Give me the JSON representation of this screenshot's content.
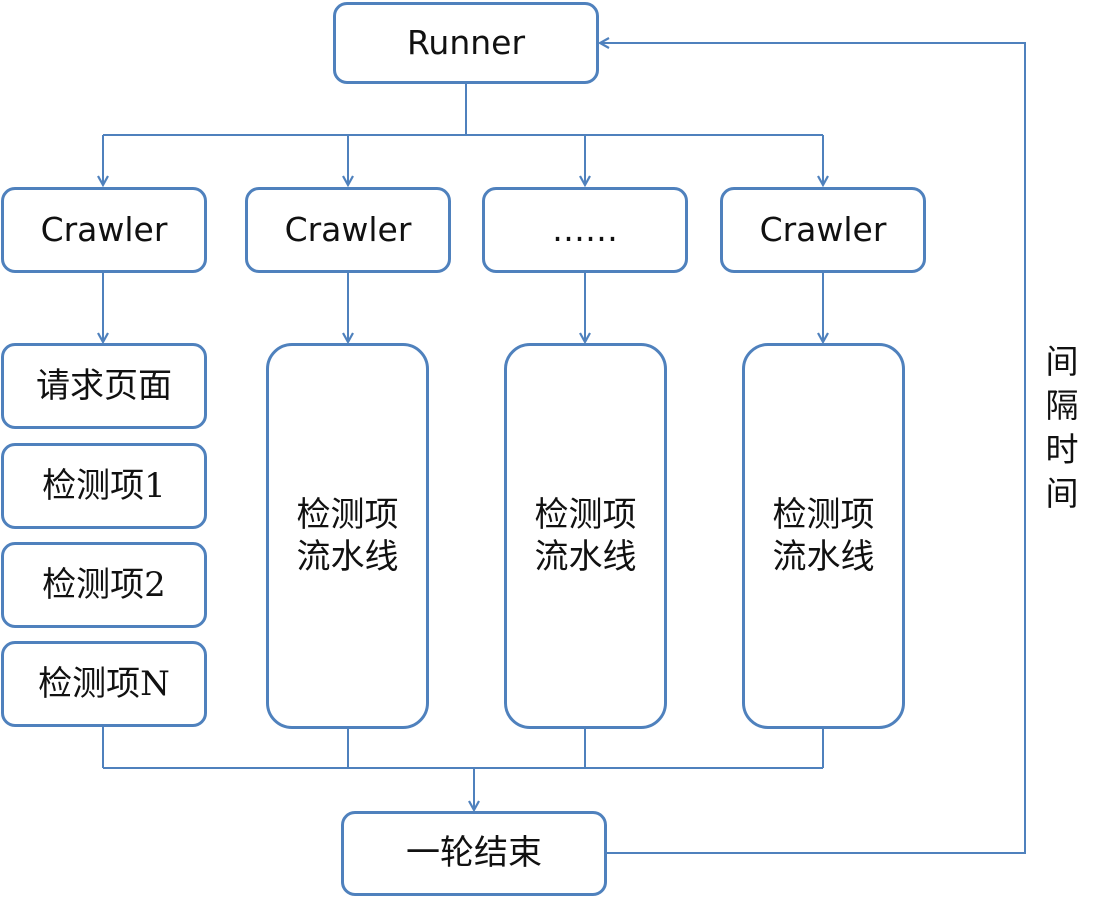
{
  "diagram": {
    "runner": "Runner",
    "crawlers": [
      "Crawler",
      "Crawler",
      "……",
      "Crawler"
    ],
    "steps": [
      "请求页面",
      "检测项1",
      "检测项2",
      "检测项N"
    ],
    "pipeline": "检测项\n流水线",
    "end": "一轮结束",
    "interval": "间隔时间"
  },
  "colors": {
    "box_border": "#4f81bd",
    "connector": "#4f81bd",
    "text": "#111111"
  }
}
